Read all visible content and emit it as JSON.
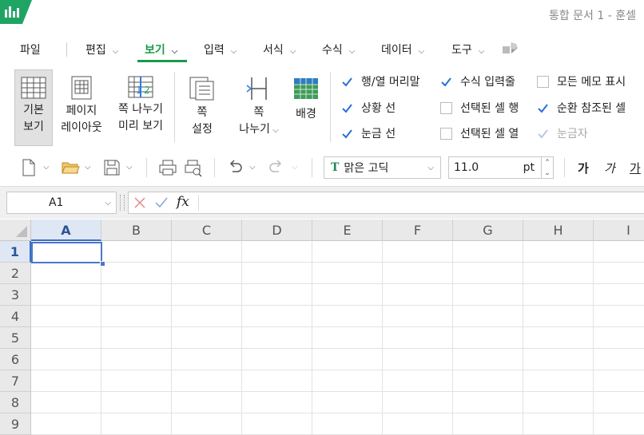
{
  "app": {
    "title": "통합 문서 1 - 훈셀",
    "brand_color": "#1fa463"
  },
  "menu": {
    "items": [
      {
        "label": "파일"
      },
      {
        "label": "편집"
      },
      {
        "label": "보기",
        "active": true
      },
      {
        "label": "입력"
      },
      {
        "label": "서식"
      },
      {
        "label": "수식"
      },
      {
        "label": "데이터"
      },
      {
        "label": "도구"
      }
    ],
    "active_color": "#1a9a4a"
  },
  "ribbon": {
    "view_buttons": [
      {
        "line1": "기본",
        "line2": "보기",
        "icon": "normal-view-icon",
        "active": true
      },
      {
        "line1": "페이지",
        "line2": "레이아웃",
        "icon": "page-layout-icon"
      },
      {
        "line1": "쪽 나누기",
        "line2": "미리 보기",
        "icon": "page-break-preview-icon"
      },
      {
        "line1": "쪽",
        "line2": "설정",
        "icon": "page-setup-icon"
      },
      {
        "line1": "쪽",
        "line2": "나누기",
        "icon": "page-break-icon"
      },
      {
        "line1": "배경",
        "line2": "",
        "icon": "background-icon"
      }
    ],
    "checkboxes": [
      {
        "label": "행/열 머리말",
        "checked": true
      },
      {
        "label": "상황 선",
        "checked": true
      },
      {
        "label": "눈금 선",
        "checked": true
      },
      {
        "label": "수식 입력줄",
        "checked": true
      },
      {
        "label": "선택된 셀 행",
        "checked": false
      },
      {
        "label": "선택된 셀 열",
        "checked": false
      },
      {
        "label": "모든 메모 표시",
        "checked": false
      },
      {
        "label": "순환 참조된 셀",
        "checked": true
      },
      {
        "label": "눈금자",
        "checked": true,
        "disabled": true
      }
    ]
  },
  "toolbar": {
    "font_name": "맑은 고딕",
    "font_size": "11.0",
    "font_unit": "pt",
    "bold_label": "가",
    "italic_label": "가",
    "underline_label": "가"
  },
  "formula_bar": {
    "name_box": "A1",
    "fx_label": "fx",
    "value": ""
  },
  "sheet": {
    "columns": [
      "A",
      "B",
      "C",
      "D",
      "E",
      "F",
      "G",
      "H",
      "I"
    ],
    "rows": [
      "1",
      "2",
      "3",
      "4",
      "5",
      "6",
      "7",
      "8",
      "9"
    ],
    "selected_cell": "A1",
    "selection_color": "#4a78c9"
  }
}
